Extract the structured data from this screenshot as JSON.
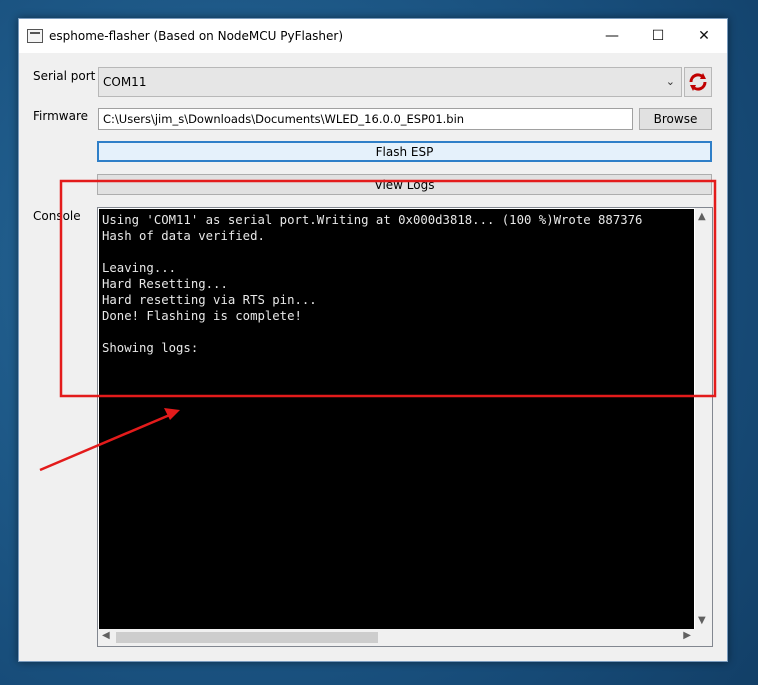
{
  "window": {
    "title": "esphome-flasher (Based on NodeMCU PyFlasher)",
    "controls": {
      "minimize": "—",
      "maximize": "☐",
      "close": "✕"
    }
  },
  "serial_port": {
    "label": "Serial port",
    "selected": "COM11",
    "refresh_icon": "refresh-icon"
  },
  "firmware": {
    "label": "Firmware",
    "path": "C:\\Users\\jim_s\\Downloads\\Documents\\WLED_16.0.0_ESP01.bin",
    "browse_label": "Browse"
  },
  "actions": {
    "flash_label": "Flash ESP",
    "view_logs_label": "View Logs"
  },
  "console": {
    "label": "Console",
    "output": "Using 'COM11' as serial port.Writing at 0x000d3818... (100 %)Wrote 887376\nHash of data verified.\n\nLeaving...\nHard Resetting...\nHard resetting via RTS pin...\nDone! Flashing is complete!\n\nShowing logs:"
  },
  "colors": {
    "highlight_box": "#e31b1b",
    "arrow": "#e31b1b",
    "accent": "#2f7fc8"
  }
}
